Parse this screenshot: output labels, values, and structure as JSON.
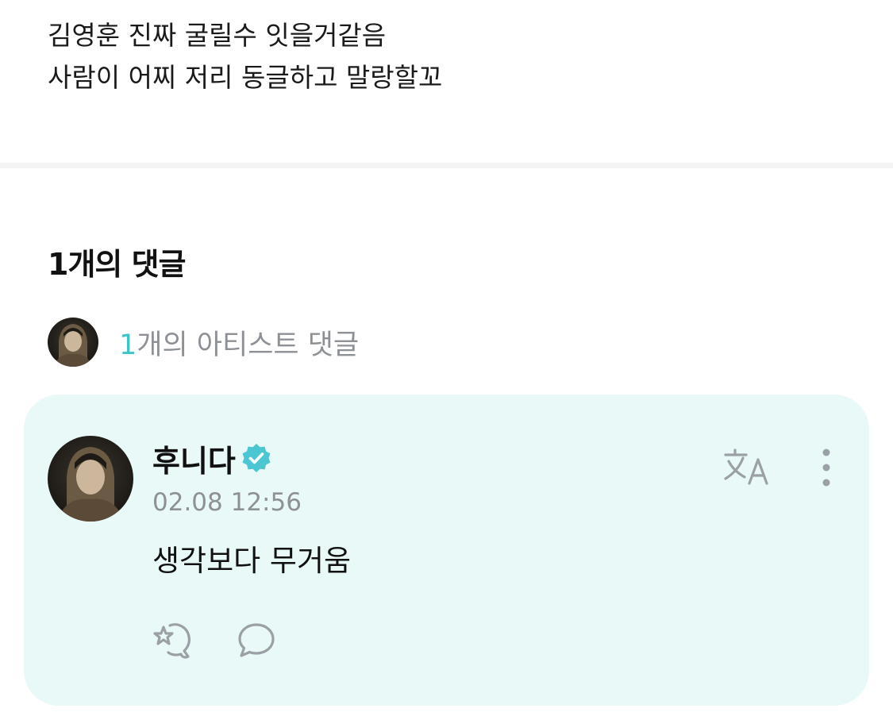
{
  "post": {
    "lines": [
      "김영훈 진짜 굴릴수 잇을거같음",
      "사람이 어찌 저리 동글하고 말랑할꼬"
    ]
  },
  "comments_section": {
    "header": "1개의 댓글"
  },
  "artist_summary": {
    "count": "1",
    "label": "개의 아티스트 댓글"
  },
  "comment": {
    "author": "후니다",
    "timestamp": "02.08 12:56",
    "text": "생각보다 무거움",
    "verified": true
  },
  "icons": {
    "verified": "verified-check-icon",
    "translate": "translate-icon",
    "more": "more-vertical-icon",
    "reaction": "reaction-icon",
    "reply": "reply-bubble-icon"
  },
  "colors": {
    "accent": "#3fc3c9",
    "card_background": "#e8f9f7",
    "muted_text": "#8d9196",
    "icon_gray": "#9aa0a6",
    "divider": "#f3f4f5"
  }
}
